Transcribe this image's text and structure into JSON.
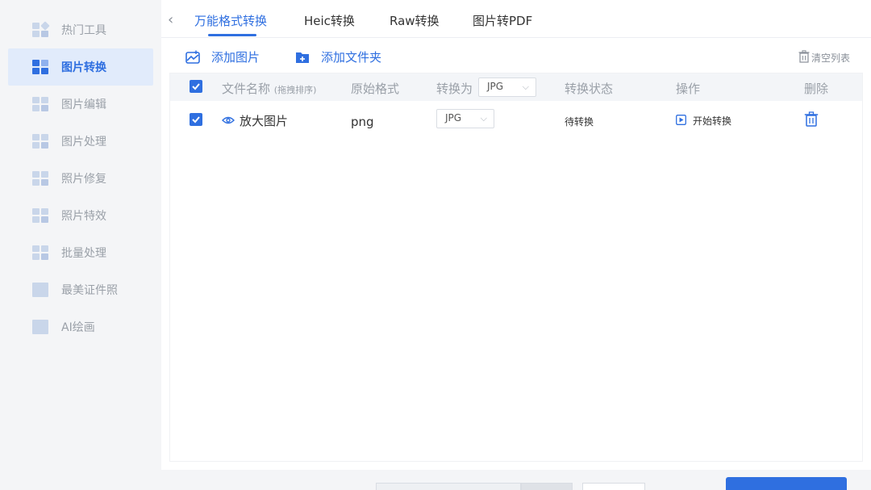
{
  "sidebar": {
    "items": [
      {
        "label": "热门工具"
      },
      {
        "label": "图片转换"
      },
      {
        "label": "图片编辑"
      },
      {
        "label": "图片处理"
      },
      {
        "label": "照片修复"
      },
      {
        "label": "照片特效"
      },
      {
        "label": "批量处理"
      },
      {
        "label": "最美证件照"
      },
      {
        "label": "AI绘画"
      }
    ],
    "active_index": 1
  },
  "tabs": [
    {
      "label": "万能格式转换",
      "active": true
    },
    {
      "label": "Heic转换",
      "active": false
    },
    {
      "label": "Raw转换",
      "active": false
    },
    {
      "label": "图片转PDF",
      "active": false
    }
  ],
  "toolbar": {
    "add_image": "添加图片",
    "add_folder": "添加文件夹",
    "clear_list": "清空列表"
  },
  "table": {
    "headers": {
      "name": "文件名称",
      "name_hint": "(拖拽排序)",
      "orig_format": "原始格式",
      "convert_to": "转换为",
      "convert_to_value": "JPG",
      "status": "转换状态",
      "action": "操作",
      "delete": "删除"
    },
    "rows": [
      {
        "checked": true,
        "name": "放大图片",
        "orig_format": "png",
        "target_format": "JPG",
        "status": "待转换",
        "action": "开始转换"
      }
    ]
  },
  "colors": {
    "accent": "#2f6fe0",
    "sidebar_active_bg": "#e1ebfb"
  }
}
